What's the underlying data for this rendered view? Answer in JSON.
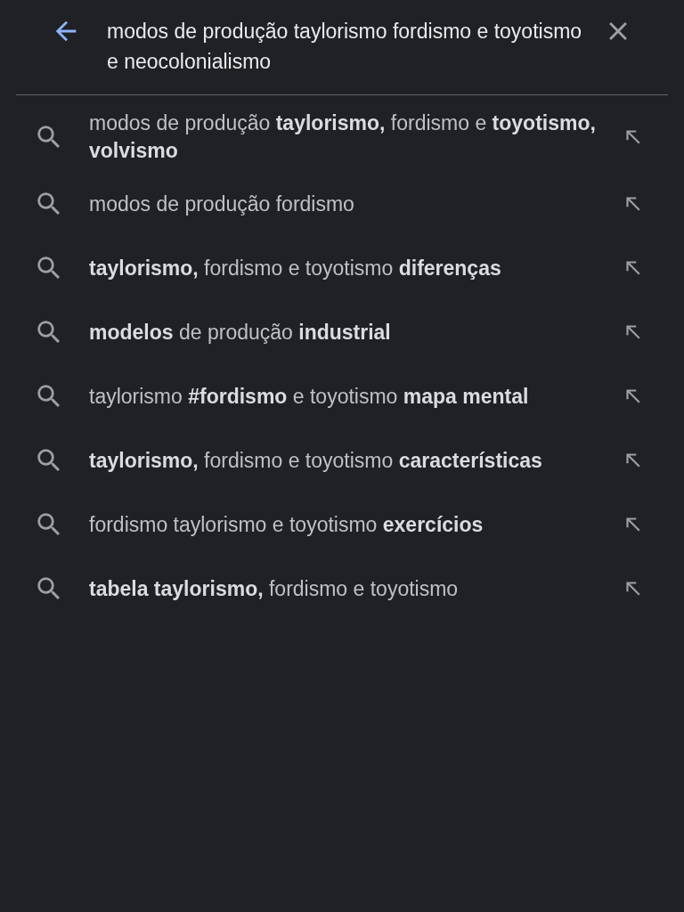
{
  "search": {
    "value": "modos de produção taylorismo fordismo e toyotismo e neocolonialismo"
  },
  "suggestions": [
    {
      "text": "modos de produção **taylorismo,** fordismo e **toyotismo, volvismo**"
    },
    {
      "text": "modos de produção fordismo"
    },
    {
      "text": "**taylorismo,** fordismo e toyotismo **diferenças**"
    },
    {
      "text": "**modelos** de produção **industrial**"
    },
    {
      "text": "taylorismo **#fordismo** e toyotismo **mapa mental**"
    },
    {
      "text": "**taylorismo,** fordismo e toyotismo **características**"
    },
    {
      "text": "fordismo taylorismo e toyotismo **exercícios**"
    },
    {
      "text": "**tabela taylorismo,** fordismo e toyotismo"
    }
  ]
}
